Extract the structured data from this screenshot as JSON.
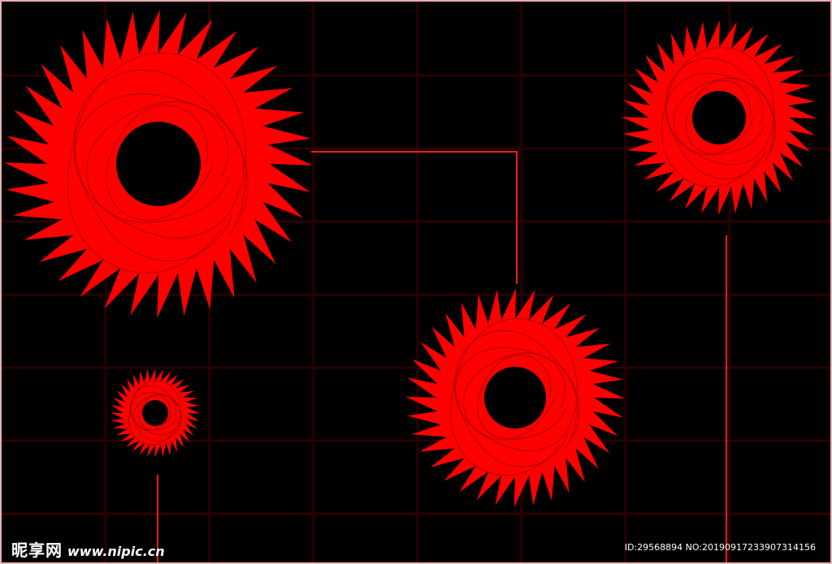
{
  "scene": {
    "background": "#000000",
    "frame_color": "#e8b0b0",
    "grid_color": "#2a0000",
    "line_color": "#ff1a1a",
    "rosette_color": "#ff0000",
    "center_color": "#000000"
  },
  "watermark": {
    "site_name": "昵享网",
    "url": "www.nipic.cn",
    "id_text": "ID:29568894 NO:20190917233907314156"
  }
}
